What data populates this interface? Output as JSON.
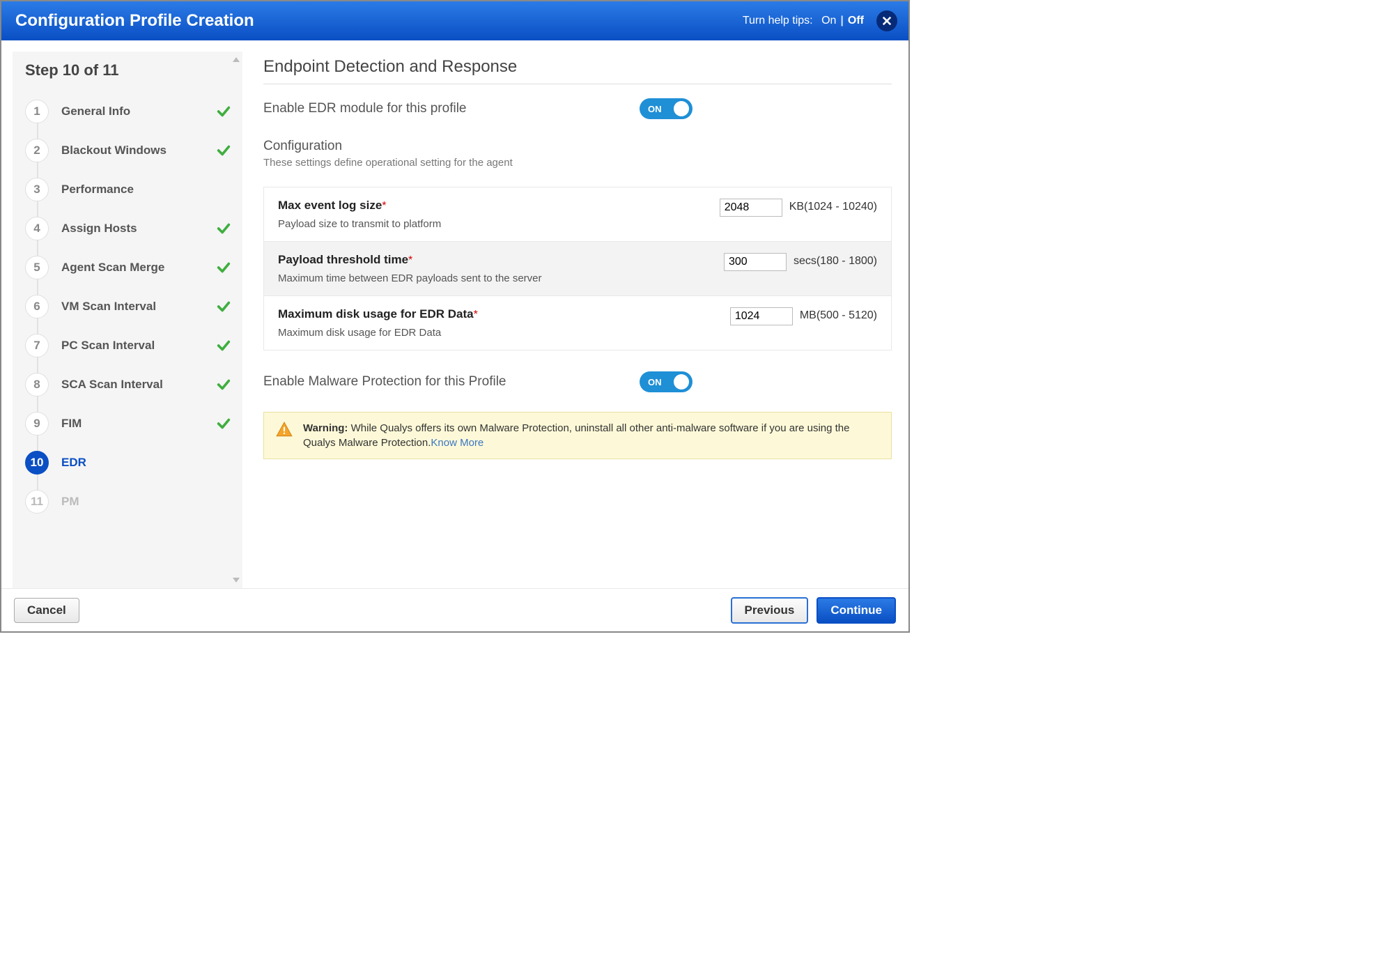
{
  "header": {
    "title": "Configuration Profile Creation",
    "help_label": "Turn help tips:",
    "help_on": "On",
    "help_off": "Off"
  },
  "sidebar": {
    "step_title": "Step 10 of 11",
    "items": [
      {
        "num": "1",
        "label": "General Info",
        "status": "done"
      },
      {
        "num": "2",
        "label": "Blackout Windows",
        "status": "done"
      },
      {
        "num": "3",
        "label": "Performance",
        "status": "pending-line"
      },
      {
        "num": "4",
        "label": "Assign Hosts",
        "status": "done"
      },
      {
        "num": "5",
        "label": "Agent Scan Merge",
        "status": "done"
      },
      {
        "num": "6",
        "label": "VM Scan Interval",
        "status": "done"
      },
      {
        "num": "7",
        "label": "PC Scan Interval",
        "status": "done"
      },
      {
        "num": "8",
        "label": "SCA Scan Interval",
        "status": "done"
      },
      {
        "num": "9",
        "label": "FIM",
        "status": "done"
      },
      {
        "num": "10",
        "label": "EDR",
        "status": "active"
      },
      {
        "num": "11",
        "label": "PM",
        "status": "pending"
      }
    ]
  },
  "main": {
    "title": "Endpoint Detection and Response",
    "enable_edr_label": "Enable EDR module for this profile",
    "enable_edr_state": "ON",
    "config_heading": "Configuration",
    "config_desc": "These settings define operational setting for the agent",
    "rows": [
      {
        "name": "Max event log size",
        "required": true,
        "desc": "Payload size to transmit to platform",
        "value": "2048",
        "unit": "KB(1024 - 10240)"
      },
      {
        "name": "Payload threshold time",
        "required": true,
        "desc": "Maximum time between EDR payloads sent to the server",
        "value": "300",
        "unit": "secs(180 - 1800)"
      },
      {
        "name": "Maximum disk usage for EDR Data",
        "required": true,
        "desc": "Maximum disk usage for EDR Data",
        "value": "1024",
        "unit": "MB(500 - 5120)"
      }
    ],
    "enable_malware_label": "Enable Malware Protection for this Profile",
    "enable_malware_state": "ON",
    "warning_prefix": "Warning:",
    "warning_text": " While Qualys offers its own Malware Protection, uninstall all other anti-malware software if you are using the Qualys Malware Protection.",
    "know_more": "Know More"
  },
  "footer": {
    "cancel": "Cancel",
    "previous": "Previous",
    "continue": "Continue"
  }
}
